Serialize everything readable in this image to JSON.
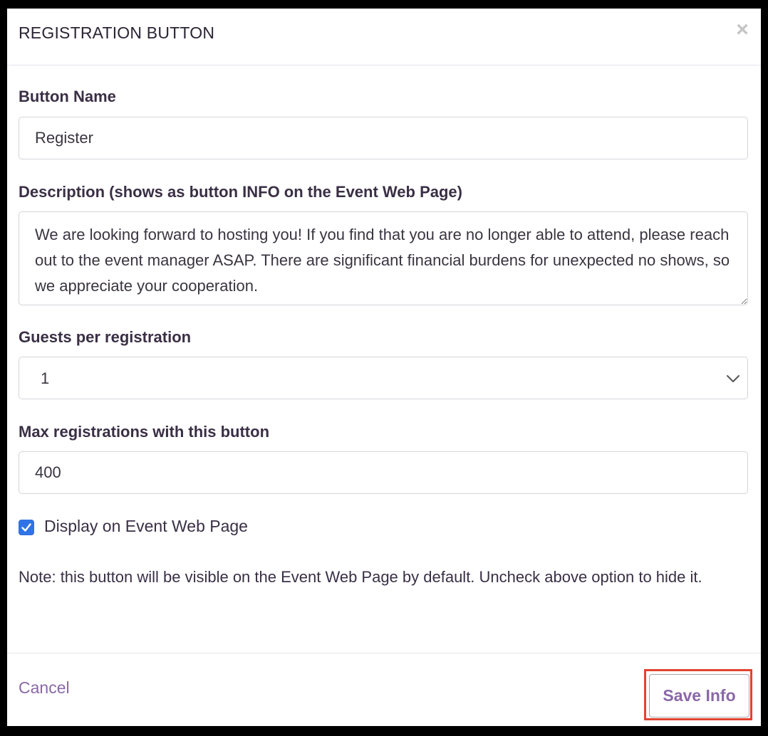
{
  "modal": {
    "title": "REGISTRATION BUTTON",
    "close_symbol": "×"
  },
  "form": {
    "button_name": {
      "label": "Button Name",
      "value": "Register"
    },
    "description": {
      "label": "Description (shows as button INFO on the Event Web Page)",
      "value": "We are looking forward to hosting you! If you find that you are no longer able to attend, please reach out to the event manager ASAP. There are significant financial burdens for unexpected no shows, so we appreciate your cooperation."
    },
    "guests": {
      "label": "Guests per registration",
      "selected": "1"
    },
    "max_registrations": {
      "label": "Max registrations with this button",
      "value": "400"
    },
    "display_checkbox": {
      "label": "Display on Event Web Page",
      "checked": true
    },
    "note": "Note: this button will be visible on the Event Web Page by default. Uncheck above option to hide it."
  },
  "footer": {
    "cancel_label": "Cancel",
    "save_label": "Save Info"
  },
  "colors": {
    "accent": "#8a68a8",
    "checkbox": "#2f73e6",
    "highlight": "#e2442f"
  },
  "icons": {
    "close": "close-icon",
    "chevron": "chevron-down-icon",
    "check": "checkmark-icon"
  }
}
